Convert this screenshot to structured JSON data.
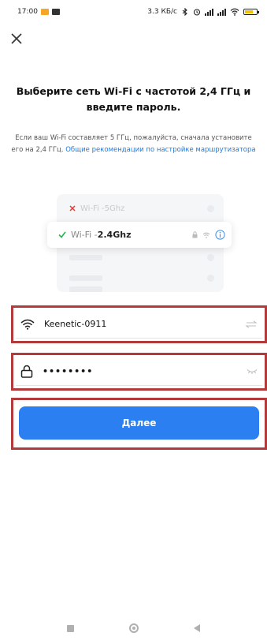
{
  "status_bar": {
    "time": "17:00",
    "speed": "3.3 КБ/с",
    "notification_colors": [
      "#f5a623",
      "#333333"
    ],
    "battery_color": "#f2c200",
    "icons": [
      "notification-icon",
      "gallery-icon",
      "bluetooth-icon",
      "alarm-icon",
      "signal-icon",
      "signal-icon",
      "wifi-icon",
      "battery-icon"
    ]
  },
  "header": {
    "close_icon": "close-icon"
  },
  "title": "Выберите сеть Wi-Fi с частотой 2,4 ГГц и введите пароль.",
  "description": {
    "text": "Если ваш Wi-Fi составляет 5 ГГц, пожалуйста, сначала установите его на 2,4 ГГц.",
    "link": "Общие рекомендации по настройке маршрутизатора"
  },
  "illustration": {
    "network_5g": {
      "prefix": "Wi-Fi - ",
      "band": "5Ghz",
      "icon": "x-mark-icon",
      "icon_color": "#e53935"
    },
    "network_24g": {
      "prefix": "Wi-Fi - ",
      "band": "2.4Ghz",
      "icon": "checkmark-icon",
      "icon_color": "#2bb24c"
    },
    "placeholder_rows": 3
  },
  "form": {
    "ssid": {
      "value": "Keenetic-0911",
      "icon": "wifi-icon",
      "action_icon": "swap-icon"
    },
    "password": {
      "value": "••••••••",
      "icon": "lock-icon",
      "action_icon": "eye-closed-icon"
    }
  },
  "next_button": {
    "label": "Далее",
    "color": "#2b7ff0"
  },
  "highlight_color": "#b33a3a",
  "nav_bar": {
    "icons": [
      "recent-apps-icon",
      "home-icon",
      "back-icon"
    ]
  }
}
